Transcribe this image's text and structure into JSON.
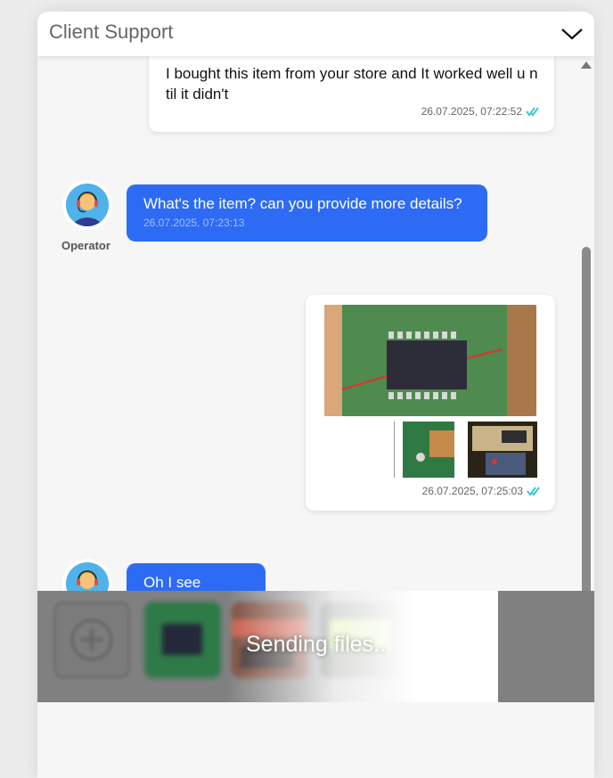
{
  "header": {
    "title": "Client Support",
    "collapse_icon": "chevron-down-icon"
  },
  "messages": [
    {
      "from": "user",
      "text": "I bought this item from your store and It worked well u ntil it didn't",
      "time": "26.07.2025, 07:22:52",
      "status_icon": "double-check-icon"
    },
    {
      "from": "operator",
      "text": "What's the item? can you provide more details?",
      "time": "26.07.2025, 07:23:13",
      "sender_label": "Operator"
    },
    {
      "from": "user",
      "images": [
        "pcb-chip-closeup",
        "pcb-board-partial",
        "lcd-breadboard"
      ],
      "time": "26.07.2025, 07:25:03",
      "status_icon": "double-check-icon"
    },
    {
      "from": "operator",
      "text": "Oh I see"
    }
  ],
  "upload": {
    "status_text": "Sending files..",
    "add_icon": "plus-circle-icon",
    "thumbnails": [
      "pcb-chip-closeup",
      "tools-photo",
      "lcd-green",
      "breadboard-photo"
    ]
  },
  "colors": {
    "operator_bubble": "#2d6bf5",
    "check_mark": "#3cc6d6",
    "avatar_bg": "#4fb2ea"
  }
}
